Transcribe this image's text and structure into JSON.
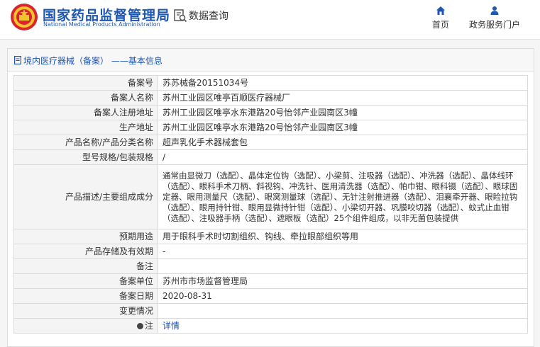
{
  "header": {
    "brand_cn": "国家药品监督管理局",
    "brand_en": "National Medical Products Administration",
    "query_label": "数据查询",
    "nav": [
      {
        "label": "首页",
        "icon": "home-icon"
      },
      {
        "label": "政务服务门户",
        "icon": "user-icon"
      }
    ]
  },
  "panel": {
    "title": "境内医疗器械（备案） ——基本信息"
  },
  "rows": [
    {
      "label": "备案号",
      "value": "苏苏械备20151034号"
    },
    {
      "label": "备案人名称",
      "value": "苏州工业园区唯亭百顺医疗器械厂"
    },
    {
      "label": "备案人注册地址",
      "value": "苏州工业园区唯亭水东港路20号怡邻产业园南区3幢"
    },
    {
      "label": "生产地址",
      "value": "苏州工业园区唯亭水东港路20号怡邻产业园南区3幢"
    },
    {
      "label": "产品名称/产品分类名称",
      "value": "超声乳化手术器械套包"
    },
    {
      "label": "型号规格/包装规格",
      "value": "/"
    },
    {
      "label": "产品描述/主要组成成分",
      "value": "通常由显微刀（选配）、晶体定位钩（选配）、小梁剪、注吸器（选配）、冲洗器（选配）、晶体线环（选配）、眼科手术刀柄、斜视钩、冲洗针、医用清洗器（选配）、帕巾钳、眼科镊（选配）、眼球固定器、眼用测量尺（选配）、眼窝测量球（选配）、无针注射推进器（选配）、泪襄牵开器、眼睑拉钩（选配）、眼用持针钳、眼用显微持针钳（选配）、小梁切开器、巩膜咬切器（选配）、蚊式止血钳（选配）、注吸器手柄（选配）、遮眼板（选配）25个组件组成，以非无菌包装提供"
    },
    {
      "label": "预期用途",
      "value": "用于眼科手术时切割组织、钩线、牵拉眼部组织等用"
    },
    {
      "label": "产品存储及有效期",
      "value": "-"
    },
    {
      "label": "备注",
      "value": ""
    },
    {
      "label": "备案单位",
      "value": "苏州市市场监督管理局"
    },
    {
      "label": "备案日期",
      "value": "2020-08-31"
    },
    {
      "label": "变更情况",
      "value": ""
    },
    {
      "label": "注",
      "value": "详情"
    }
  ]
}
